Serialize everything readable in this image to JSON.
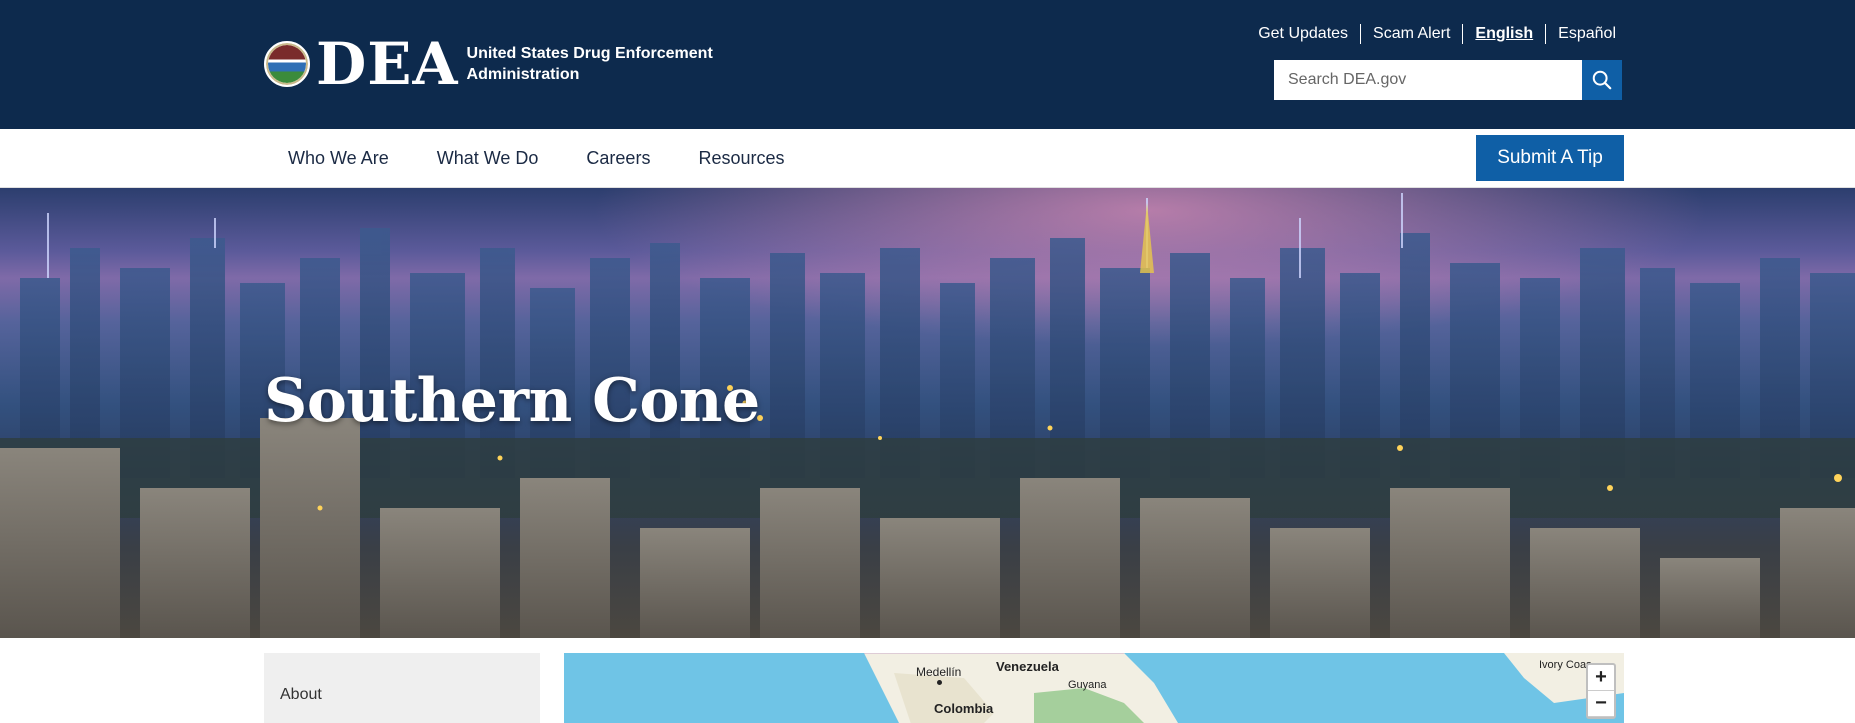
{
  "header": {
    "logo_text": "DEA",
    "agency_name": "United States Drug Enforcement Administration",
    "utility_links": [
      {
        "label": "Get Updates"
      },
      {
        "label": "Scam Alert"
      },
      {
        "label": "English"
      },
      {
        "label": "Español"
      }
    ],
    "search_placeholder": "Search DEA.gov"
  },
  "nav": {
    "items": [
      {
        "label": "Who We Are"
      },
      {
        "label": "What We Do"
      },
      {
        "label": "Careers"
      },
      {
        "label": "Resources"
      }
    ],
    "tip_button": "Submit A Tip"
  },
  "hero": {
    "title": "Southern Cone"
  },
  "sidebar": {
    "items": [
      {
        "label": "About"
      }
    ]
  },
  "map": {
    "labels": {
      "medellin": "Medellín",
      "venezuela": "Venezuela",
      "guyana": "Guyana",
      "colombia": "Colombia",
      "ivory_coast": "Ivory Coas"
    },
    "zoom_in": "+",
    "zoom_out": "−"
  },
  "colors": {
    "header_bg": "#0d2a4d",
    "accent": "#0f5fa6",
    "ocean": "#6fc4e6"
  }
}
